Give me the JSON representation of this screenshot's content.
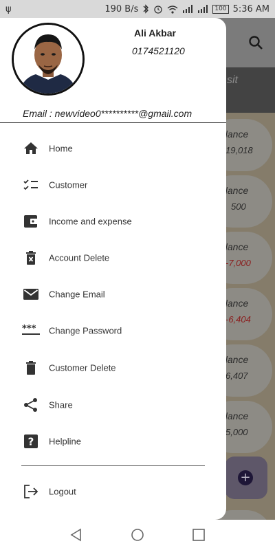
{
  "status_bar": {
    "usb_icon": "usb-icon",
    "speed": "190 B/s",
    "time": "5:36 AM",
    "battery": "100"
  },
  "background": {
    "tab_text": "sit",
    "cards": [
      {
        "label": "alance",
        "value": "19,018",
        "negative": false
      },
      {
        "label": "alance",
        "value": "500",
        "negative": false
      },
      {
        "label": "alance",
        "value": "-7,000",
        "negative": true
      },
      {
        "label": "alance",
        "value": "-6,404",
        "negative": true
      },
      {
        "label": "alance",
        "value": "6,407",
        "negative": false
      },
      {
        "label": "alance",
        "value": "5,000",
        "negative": false
      }
    ]
  },
  "drawer": {
    "user": {
      "name": "Ali Akbar",
      "phone": "0174521120",
      "email": "Email : newvideo0**********@gmail.com"
    },
    "menu": [
      {
        "label": "Home",
        "icon": "home-icon"
      },
      {
        "label": "Customer",
        "icon": "checklist-icon"
      },
      {
        "label": "Income and expense",
        "icon": "wallet-icon"
      },
      {
        "label": "Account Delete",
        "icon": "delete-forever-icon"
      },
      {
        "label": "Change Email",
        "icon": "email-icon"
      },
      {
        "label": "Change Password",
        "icon": "password-icon"
      },
      {
        "label": "Customer Delete",
        "icon": "trash-icon"
      },
      {
        "label": "Share",
        "icon": "share-icon"
      },
      {
        "label": "Helpline",
        "icon": "help-icon"
      }
    ],
    "logout": {
      "label": "Logout",
      "icon": "logout-icon"
    }
  },
  "colors": {
    "drawer_bg": "#ffffff",
    "icon": "#333333",
    "scrim": "#8a8a8a"
  }
}
